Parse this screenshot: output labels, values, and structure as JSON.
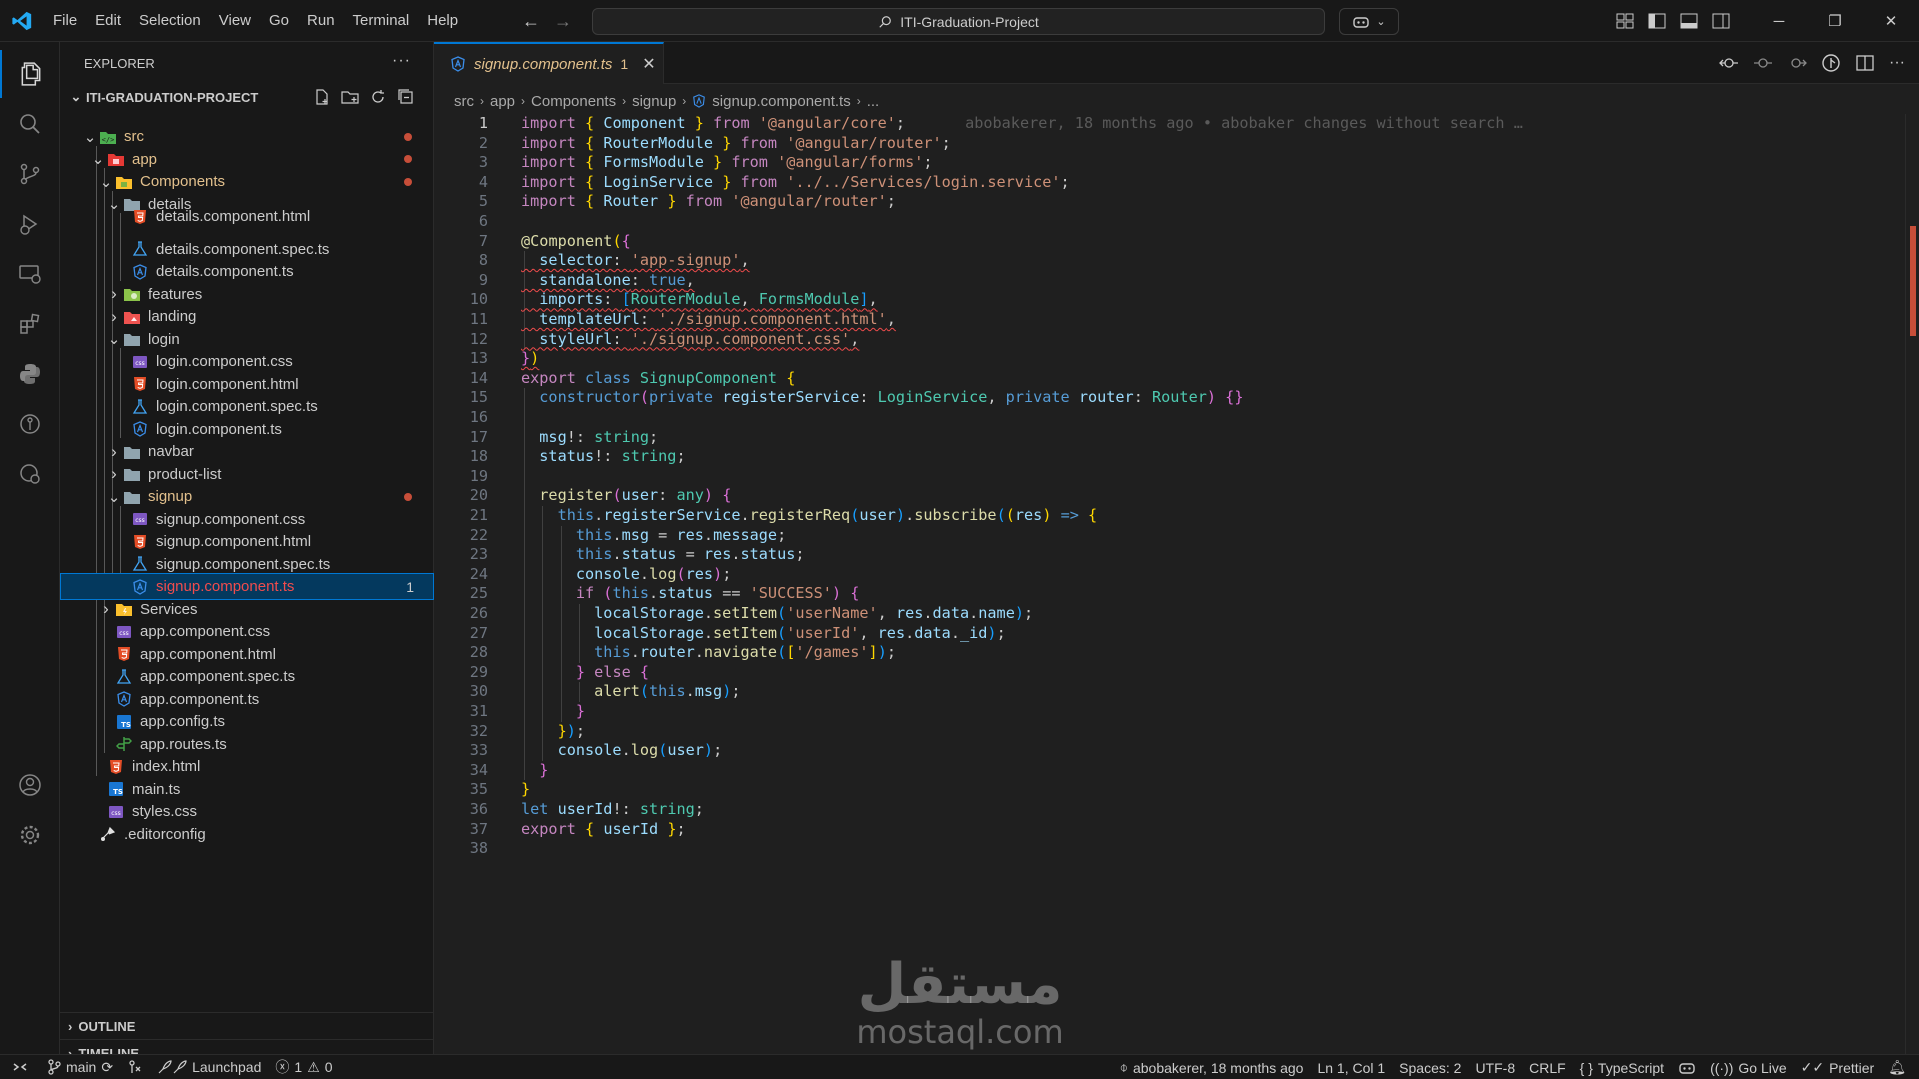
{
  "menu": [
    "File",
    "Edit",
    "Selection",
    "View",
    "Go",
    "Run",
    "Terminal",
    "Help"
  ],
  "command_center": {
    "text": "ITI-Graduation-Project"
  },
  "sidebar": {
    "title": "EXPLORER",
    "more": "···",
    "project": "ITI-GRADUATION-PROJECT",
    "tree": [
      {
        "label": "src",
        "depth": 1,
        "kind": "folder-open",
        "icon": "src-folder-icon",
        "modified": true
      },
      {
        "label": "app",
        "depth": 2,
        "kind": "folder-open",
        "icon": "app-folder-icon",
        "modified": true
      },
      {
        "label": "Components",
        "depth": 3,
        "kind": "folder-open",
        "icon": "components-folder-icon",
        "modified": true
      },
      {
        "label": "details",
        "depth": 4,
        "kind": "folder-open",
        "icon": "folder-icon"
      },
      {
        "label": "details.component.html",
        "depth": 5,
        "kind": "file",
        "icon": "html-file-icon",
        "clipped": true
      },
      {
        "label": "details.component.spec.ts",
        "depth": 5,
        "kind": "file",
        "icon": "spec-file-icon"
      },
      {
        "label": "details.component.ts",
        "depth": 5,
        "kind": "file",
        "icon": "angular-file-icon"
      },
      {
        "label": "features",
        "depth": 4,
        "kind": "folder",
        "icon": "features-folder-icon"
      },
      {
        "label": "landing",
        "depth": 4,
        "kind": "folder",
        "icon": "landing-folder-icon"
      },
      {
        "label": "login",
        "depth": 4,
        "kind": "folder-open",
        "icon": "folder-icon"
      },
      {
        "label": "login.component.css",
        "depth": 5,
        "kind": "file",
        "icon": "css-file-icon"
      },
      {
        "label": "login.component.html",
        "depth": 5,
        "kind": "file",
        "icon": "html-file-icon"
      },
      {
        "label": "login.component.spec.ts",
        "depth": 5,
        "kind": "file",
        "icon": "spec-file-icon"
      },
      {
        "label": "login.component.ts",
        "depth": 5,
        "kind": "file",
        "icon": "angular-file-icon"
      },
      {
        "label": "navbar",
        "depth": 4,
        "kind": "folder",
        "icon": "folder-icon"
      },
      {
        "label": "product-list",
        "depth": 4,
        "kind": "folder",
        "icon": "folder-icon"
      },
      {
        "label": "signup",
        "depth": 4,
        "kind": "folder-open",
        "icon": "folder-icon",
        "modified": true
      },
      {
        "label": "signup.component.css",
        "depth": 5,
        "kind": "file",
        "icon": "css-file-icon"
      },
      {
        "label": "signup.component.html",
        "depth": 5,
        "kind": "file",
        "icon": "html-file-icon"
      },
      {
        "label": "signup.component.spec.ts",
        "depth": 5,
        "kind": "file",
        "icon": "spec-file-icon"
      },
      {
        "label": "signup.component.ts",
        "depth": 5,
        "kind": "file",
        "icon": "angular-file-icon",
        "selected": true,
        "errors": "1"
      },
      {
        "label": "Services",
        "depth": 3,
        "kind": "folder",
        "icon": "services-folder-icon"
      },
      {
        "label": "app.component.css",
        "depth": 3,
        "kind": "file",
        "icon": "css-file-icon"
      },
      {
        "label": "app.component.html",
        "depth": 3,
        "kind": "file",
        "icon": "html-file-icon"
      },
      {
        "label": "app.component.spec.ts",
        "depth": 3,
        "kind": "file",
        "icon": "spec-file-icon"
      },
      {
        "label": "app.component.ts",
        "depth": 3,
        "kind": "file",
        "icon": "angular-file-icon"
      },
      {
        "label": "app.config.ts",
        "depth": 3,
        "kind": "file",
        "icon": "ts-file-icon"
      },
      {
        "label": "app.routes.ts",
        "depth": 3,
        "kind": "file",
        "icon": "routes-file-icon"
      },
      {
        "label": "index.html",
        "depth": 2,
        "kind": "file",
        "icon": "html-file-icon"
      },
      {
        "label": "main.ts",
        "depth": 2,
        "kind": "file",
        "icon": "ts-file-icon"
      },
      {
        "label": "styles.css",
        "depth": 2,
        "kind": "file",
        "icon": "css-file-icon"
      },
      {
        "label": ".editorconfig",
        "depth": 1,
        "kind": "file",
        "icon": "editorconfig-file-icon"
      }
    ],
    "outline": "OUTLINE",
    "timeline": "TIMELINE"
  },
  "tab": {
    "label": "signup.component.ts",
    "problems": "1",
    "close": "✕"
  },
  "breadcrumb": [
    "src",
    "app",
    "Components",
    "signup",
    "signup.component.ts",
    "..."
  ],
  "code": {
    "blame": "abobakerer, 18 months ago • abobaker changes without search …",
    "lines": [
      [
        [
          "import ",
          "ctl"
        ],
        [
          "{ ",
          "br1"
        ],
        [
          "Component ",
          "var"
        ],
        [
          "} ",
          "br1"
        ],
        [
          "from ",
          "ctl"
        ],
        [
          "'@angular/core'",
          "str"
        ],
        [
          ";",
          "pun"
        ]
      ],
      [
        [
          "import ",
          "ctl"
        ],
        [
          "{ ",
          "br1"
        ],
        [
          "RouterModule ",
          "var"
        ],
        [
          "} ",
          "br1"
        ],
        [
          "from ",
          "ctl"
        ],
        [
          "'@angular/router'",
          "str"
        ],
        [
          ";",
          "pun"
        ]
      ],
      [
        [
          "import ",
          "ctl"
        ],
        [
          "{ ",
          "br1"
        ],
        [
          "FormsModule ",
          "var"
        ],
        [
          "} ",
          "br1"
        ],
        [
          "from ",
          "ctl"
        ],
        [
          "'@angular/forms'",
          "str"
        ],
        [
          ";",
          "pun"
        ]
      ],
      [
        [
          "import ",
          "ctl"
        ],
        [
          "{ ",
          "br1"
        ],
        [
          "LoginService ",
          "var"
        ],
        [
          "} ",
          "br1"
        ],
        [
          "from ",
          "ctl"
        ],
        [
          "'../../Services/login.service'",
          "str"
        ],
        [
          ";",
          "pun"
        ]
      ],
      [
        [
          "import ",
          "ctl"
        ],
        [
          "{ ",
          "br1"
        ],
        [
          "Router ",
          "var"
        ],
        [
          "} ",
          "br1"
        ],
        [
          "from ",
          "ctl"
        ],
        [
          "'@angular/router'",
          "str"
        ],
        [
          ";",
          "pun"
        ]
      ],
      [],
      [
        [
          "@",
          "fn"
        ],
        [
          "Component",
          "fn"
        ],
        [
          "(",
          "br1"
        ],
        [
          "{",
          "br2"
        ]
      ],
      [
        [
          "  selector",
          "var",
          1
        ],
        [
          ": ",
          "pun",
          1
        ],
        [
          "'app-signup'",
          "str",
          1
        ],
        [
          ",",
          "pun",
          1
        ]
      ],
      [
        [
          "  standalone",
          "var",
          1
        ],
        [
          ": ",
          "pun",
          1
        ],
        [
          "true",
          "kw",
          1
        ],
        [
          ",",
          "pun",
          1
        ]
      ],
      [
        [
          "  imports",
          "var",
          1
        ],
        [
          ": ",
          "pun",
          1
        ],
        [
          "[",
          "br3",
          1
        ],
        [
          "RouterModule",
          "cls",
          1
        ],
        [
          ", ",
          "pun",
          1
        ],
        [
          "FormsModule",
          "cls",
          1
        ],
        [
          "]",
          "br3",
          1
        ],
        [
          ",",
          "pun",
          1
        ]
      ],
      [
        [
          "  templateUrl",
          "var",
          1
        ],
        [
          ": ",
          "pun",
          1
        ],
        [
          "'./signup.component.html'",
          "str",
          1
        ],
        [
          ",",
          "pun",
          1
        ]
      ],
      [
        [
          "  styleUrl",
          "var",
          1
        ],
        [
          ": ",
          "pun",
          1
        ],
        [
          "'./signup.component.css'",
          "str",
          1
        ],
        [
          ",",
          "pun",
          1
        ]
      ],
      [
        [
          "}",
          "br2",
          1
        ],
        [
          ")",
          "br1",
          1
        ]
      ],
      [
        [
          "export ",
          "ctl"
        ],
        [
          "class ",
          "kw"
        ],
        [
          "SignupComponent ",
          "cls"
        ],
        [
          "{",
          "br1"
        ]
      ],
      [
        [
          "  constructor",
          "kw"
        ],
        [
          "(",
          "br2"
        ],
        [
          "private ",
          "kw"
        ],
        [
          "registerService",
          "var"
        ],
        [
          ": ",
          "pun"
        ],
        [
          "LoginService",
          "cls"
        ],
        [
          ", ",
          "pun"
        ],
        [
          "private ",
          "kw"
        ],
        [
          "router",
          "var"
        ],
        [
          ": ",
          "pun"
        ],
        [
          "Router",
          "cls"
        ],
        [
          ") ",
          "br2"
        ],
        [
          "{}",
          "br2"
        ]
      ],
      [],
      [
        [
          "  msg",
          "var"
        ],
        [
          "!: ",
          "pun"
        ],
        [
          "string",
          "cls"
        ],
        [
          ";",
          "pun"
        ]
      ],
      [
        [
          "  status",
          "var"
        ],
        [
          "!: ",
          "pun"
        ],
        [
          "string",
          "cls"
        ],
        [
          ";",
          "pun"
        ]
      ],
      [],
      [
        [
          "  register",
          "fn"
        ],
        [
          "(",
          "br2"
        ],
        [
          "user",
          "var"
        ],
        [
          ": ",
          "pun"
        ],
        [
          "any",
          "cls"
        ],
        [
          ") ",
          "br2"
        ],
        [
          "{",
          "br2"
        ]
      ],
      [
        [
          "    this",
          "kw"
        ],
        [
          ".",
          "pun"
        ],
        [
          "registerService",
          "var"
        ],
        [
          ".",
          "pun"
        ],
        [
          "registerReq",
          "fn"
        ],
        [
          "(",
          "br3"
        ],
        [
          "user",
          "var"
        ],
        [
          ")",
          "br3"
        ],
        [
          ".",
          "pun"
        ],
        [
          "subscribe",
          "fn"
        ],
        [
          "(",
          "br3"
        ],
        [
          "(",
          "br1"
        ],
        [
          "res",
          "var"
        ],
        [
          ") ",
          "br1"
        ],
        [
          "=> ",
          "kw"
        ],
        [
          "{",
          "br1"
        ]
      ],
      [
        [
          "      this",
          "kw"
        ],
        [
          ".",
          "pun"
        ],
        [
          "msg ",
          "var"
        ],
        [
          "= ",
          "pun"
        ],
        [
          "res",
          "var"
        ],
        [
          ".",
          "pun"
        ],
        [
          "message",
          "var"
        ],
        [
          ";",
          "pun"
        ]
      ],
      [
        [
          "      this",
          "kw"
        ],
        [
          ".",
          "pun"
        ],
        [
          "status ",
          "var"
        ],
        [
          "= ",
          "pun"
        ],
        [
          "res",
          "var"
        ],
        [
          ".",
          "pun"
        ],
        [
          "status",
          "var"
        ],
        [
          ";",
          "pun"
        ]
      ],
      [
        [
          "      console",
          "var"
        ],
        [
          ".",
          "pun"
        ],
        [
          "log",
          "fn"
        ],
        [
          "(",
          "br2"
        ],
        [
          "res",
          "var"
        ],
        [
          ")",
          "br2"
        ],
        [
          ";",
          "pun"
        ]
      ],
      [
        [
          "      if ",
          "ctl"
        ],
        [
          "(",
          "br2"
        ],
        [
          "this",
          "kw"
        ],
        [
          ".",
          "pun"
        ],
        [
          "status ",
          "var"
        ],
        [
          "== ",
          "pun"
        ],
        [
          "'SUCCESS'",
          "str"
        ],
        [
          ") ",
          "br2"
        ],
        [
          "{",
          "br2"
        ]
      ],
      [
        [
          "        localStorage",
          "var"
        ],
        [
          ".",
          "pun"
        ],
        [
          "setItem",
          "fn"
        ],
        [
          "(",
          "br3"
        ],
        [
          "'userName'",
          "str"
        ],
        [
          ", ",
          "pun"
        ],
        [
          "res",
          "var"
        ],
        [
          ".",
          "pun"
        ],
        [
          "data",
          "var"
        ],
        [
          ".",
          "pun"
        ],
        [
          "name",
          "var"
        ],
        [
          ")",
          "br3"
        ],
        [
          ";",
          "pun"
        ]
      ],
      [
        [
          "        localStorage",
          "var"
        ],
        [
          ".",
          "pun"
        ],
        [
          "setItem",
          "fn"
        ],
        [
          "(",
          "br3"
        ],
        [
          "'userId'",
          "str"
        ],
        [
          ", ",
          "pun"
        ],
        [
          "res",
          "var"
        ],
        [
          ".",
          "pun"
        ],
        [
          "data",
          "var"
        ],
        [
          ".",
          "pun"
        ],
        [
          "_id",
          "var"
        ],
        [
          ")",
          "br3"
        ],
        [
          ";",
          "pun"
        ]
      ],
      [
        [
          "        this",
          "kw"
        ],
        [
          ".",
          "pun"
        ],
        [
          "router",
          "var"
        ],
        [
          ".",
          "pun"
        ],
        [
          "navigate",
          "fn"
        ],
        [
          "(",
          "br3"
        ],
        [
          "[",
          "br1"
        ],
        [
          "'/games'",
          "str"
        ],
        [
          "]",
          "br1"
        ],
        [
          ")",
          "br3"
        ],
        [
          ";",
          "pun"
        ]
      ],
      [
        [
          "      } ",
          "br2"
        ],
        [
          "else ",
          "ctl"
        ],
        [
          "{",
          "br2"
        ]
      ],
      [
        [
          "        alert",
          "fn"
        ],
        [
          "(",
          "br3"
        ],
        [
          "this",
          "kw"
        ],
        [
          ".",
          "pun"
        ],
        [
          "msg",
          "var"
        ],
        [
          ")",
          "br3"
        ],
        [
          ";",
          "pun"
        ]
      ],
      [
        [
          "      }",
          "br2"
        ]
      ],
      [
        [
          "    }",
          "br1"
        ],
        [
          ")",
          "br3"
        ],
        [
          ";",
          "pun"
        ]
      ],
      [
        [
          "    console",
          "var"
        ],
        [
          ".",
          "pun"
        ],
        [
          "log",
          "fn"
        ],
        [
          "(",
          "br3"
        ],
        [
          "user",
          "var"
        ],
        [
          ")",
          "br3"
        ],
        [
          ";",
          "pun"
        ]
      ],
      [
        [
          "  }",
          "br2"
        ]
      ],
      [
        [
          "}",
          "br1"
        ]
      ],
      [
        [
          "let ",
          "kw"
        ],
        [
          "userId",
          "var"
        ],
        [
          "!: ",
          "pun"
        ],
        [
          "string",
          "cls"
        ],
        [
          ";",
          "pun"
        ]
      ],
      [
        [
          "export ",
          "ctl"
        ],
        [
          "{ ",
          "br1"
        ],
        [
          "userId ",
          "var"
        ],
        [
          "}",
          "br1"
        ],
        [
          ";",
          "pun"
        ]
      ],
      []
    ]
  },
  "watermark": {
    "arabic": "مستقل",
    "latin": "mostaql.com"
  },
  "statusbar": {
    "branch": "main",
    "launchpad": "Launchpad",
    "errors": "1",
    "warnings": "0",
    "blame": "abobakerer, 18 months ago",
    "position": "Ln 1, Col 1",
    "spaces": "Spaces: 2",
    "encoding": "UTF-8",
    "eol": "CRLF",
    "language": "TypeScript",
    "golive": "Go Live",
    "prettier": "Prettier"
  },
  "colors": {
    "accent": "#0078d4",
    "modified": "#e2c08d",
    "error": "#f14c4c",
    "dot": "#c74e39"
  }
}
